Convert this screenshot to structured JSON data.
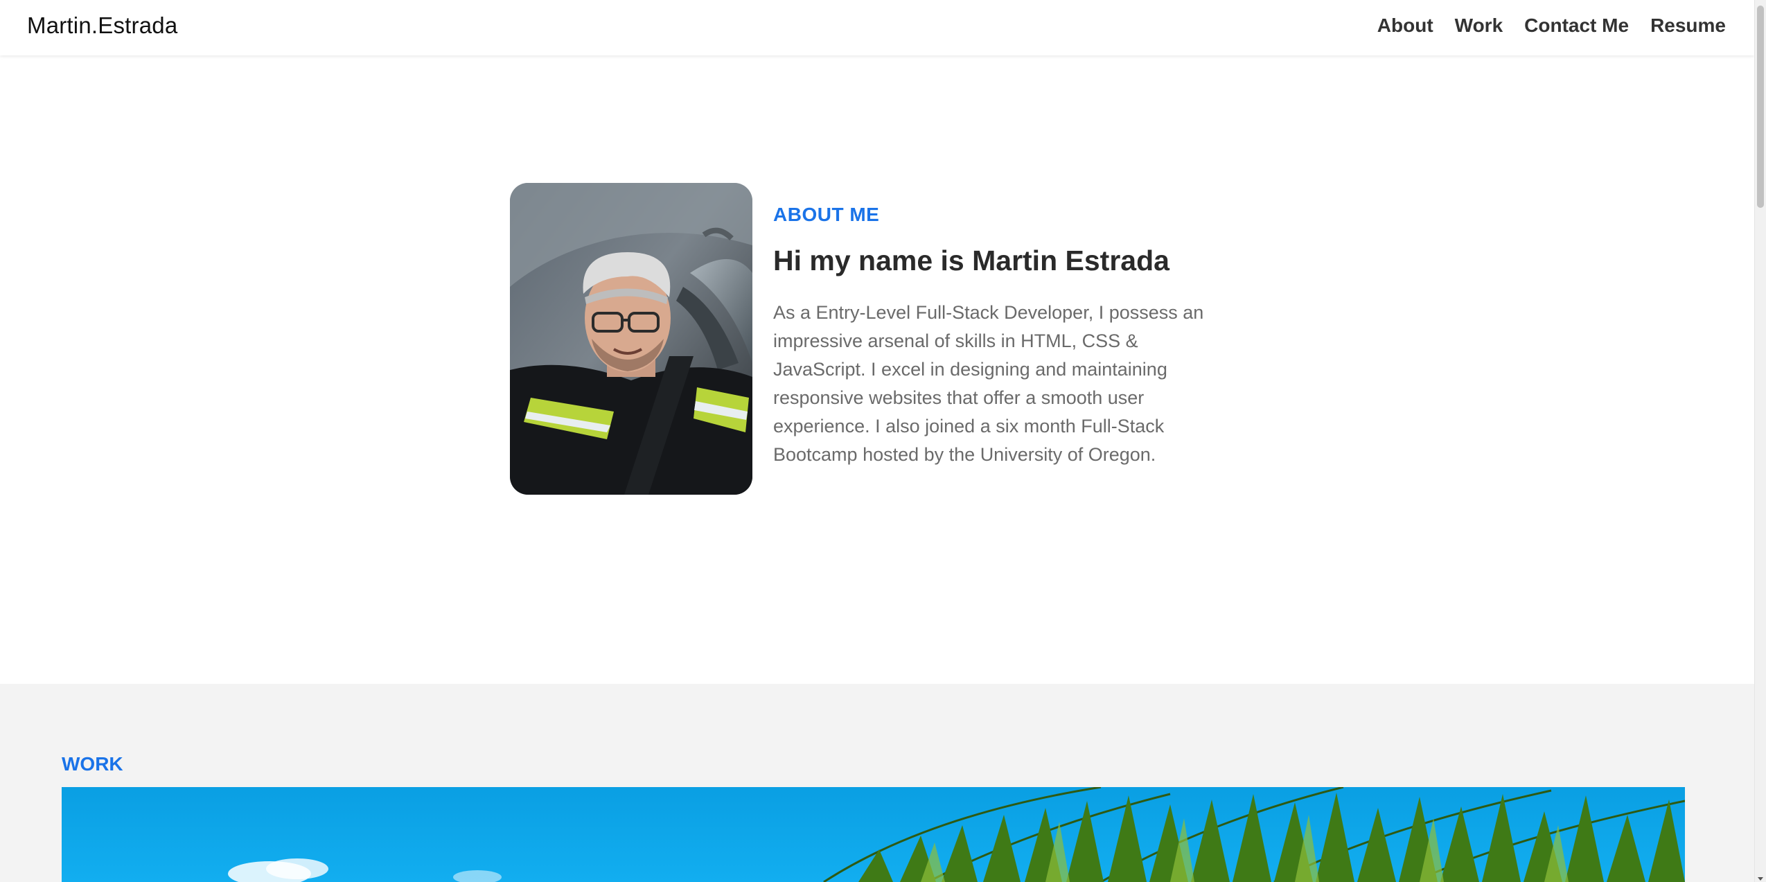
{
  "header": {
    "brand": "Martin.Estrada",
    "nav": [
      "About",
      "Work",
      "Contact Me",
      "Resume"
    ]
  },
  "about": {
    "eyebrow": "ABOUT ME",
    "heading": "Hi my name is Martin Estrada",
    "body": "As a Entry-Level Full-Stack Developer, I possess an impressive arsenal of skills in HTML, CSS & JavaScript. I excel in designing and maintaining responsive websites that offer a smooth user experience. I also joined a six month Full-Stack Bootcamp hosted by the University of Oregon.",
    "photo_icon": "profile-photo"
  },
  "work": {
    "title": "WORK",
    "banner_icon": "palm-tree-sky-image"
  },
  "colors": {
    "accent": "#1a73e8",
    "heading": "#2a2a2a",
    "body_text": "#6a6a6a",
    "work_bg": "#f3f3f3",
    "sky": "#0aa3e6"
  }
}
